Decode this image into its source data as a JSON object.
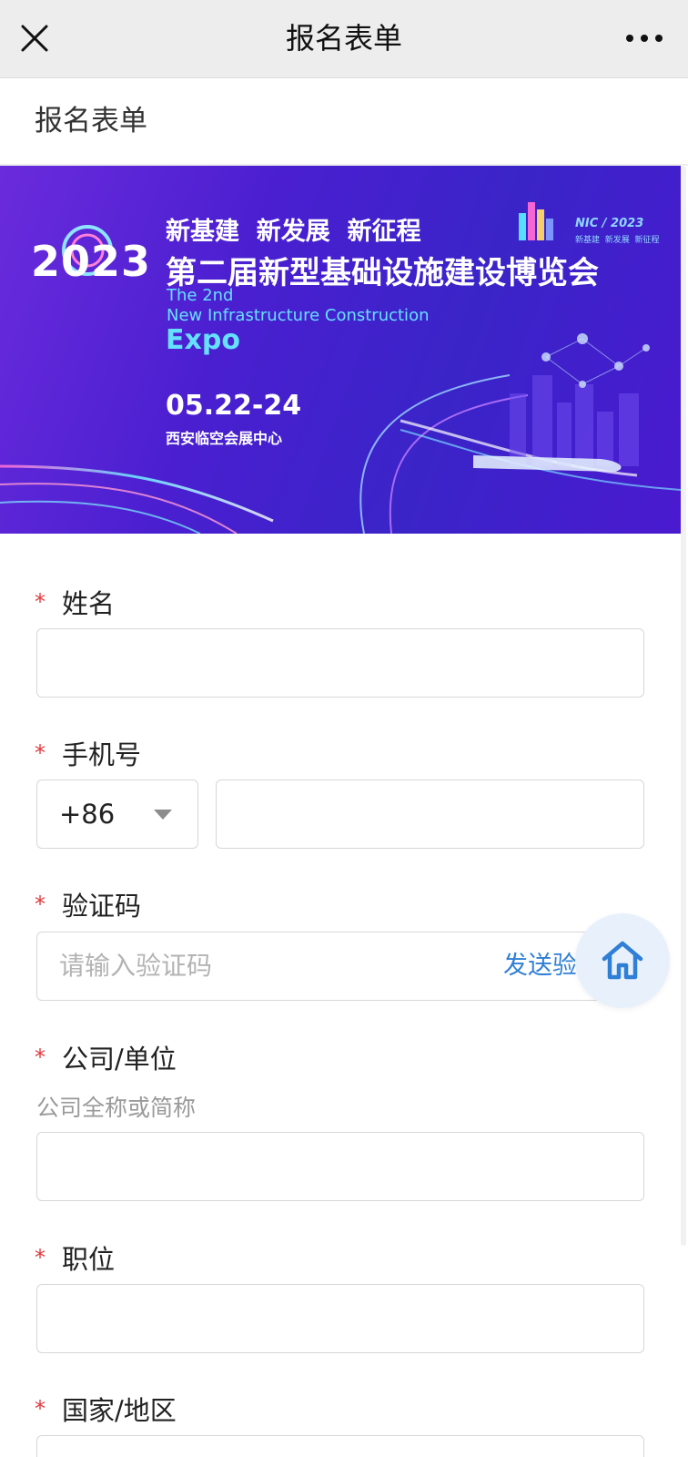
{
  "topbar": {
    "title": "报名表单"
  },
  "page": {
    "heading": "报名表单"
  },
  "banner": {
    "year": "2023",
    "slogan": "新基建  新发展  新征程",
    "title_cn": "第二届新型基础设施建设博览会",
    "title_en_1": "The 2nd",
    "title_en_2": "New Infrastructure Construction",
    "title_en_3": "Expo",
    "dates": "05.22-24",
    "venue": "西安临空会展中心",
    "logo_text": "NIC / 2023",
    "logo_sub": "新基建  新发展  新征程"
  },
  "form": {
    "name": {
      "label": "姓名"
    },
    "phone": {
      "label": "手机号",
      "country_code": "+86"
    },
    "code": {
      "label": "验证码",
      "placeholder": "请输入验证码",
      "send_label": "发送验证码"
    },
    "company": {
      "label": "公司/单位",
      "hint": "公司全称或简称"
    },
    "position": {
      "label": "职位"
    },
    "region": {
      "label": "国家/地区"
    }
  },
  "required_mark": "*",
  "colors": {
    "required": "#e0393e",
    "link": "#2f7fd6",
    "banner_primary": "#4a1fd0"
  }
}
